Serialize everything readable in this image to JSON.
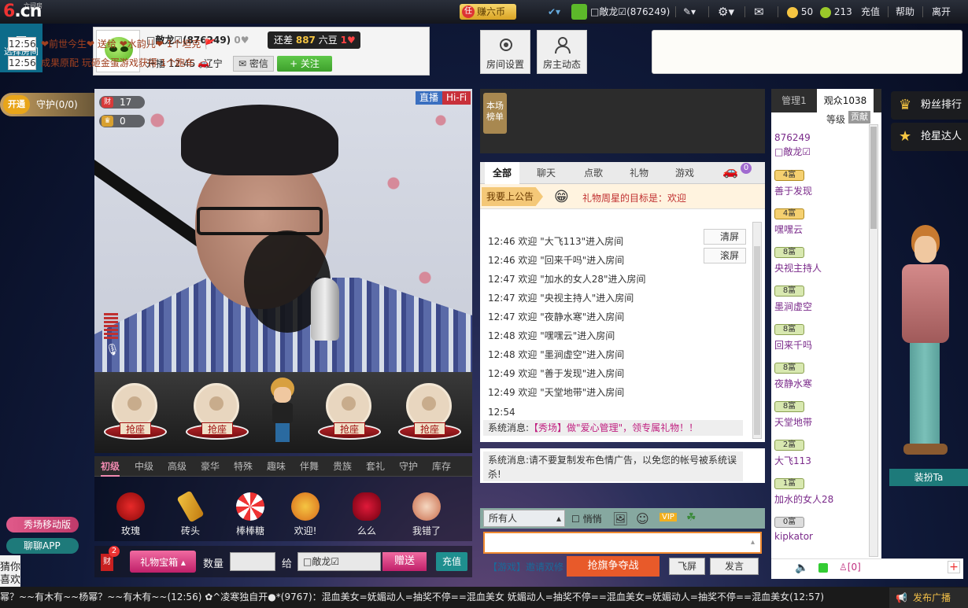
{
  "topbar": {
    "logo": "6.cn",
    "logo_sub": "六间房",
    "earn_label": "赚六币",
    "user_name": "□敵龙☑(876249)",
    "coins": "50",
    "beans": "213",
    "recharge": "充值",
    "help": "帮助",
    "leave": "离开"
  },
  "left": {
    "choose_room": "选择房间",
    "guard_open": "开通",
    "guard_label": "守护(0/0)",
    "mobile_show": "秀场移动版",
    "chat_app": "聊聊APP",
    "guess_like": "猜你喜欢"
  },
  "anchor": {
    "name": "□敵龙☑(876249)",
    "gap_prefix": "还差",
    "gap_value": "887",
    "gap_suffix": "六豆",
    "heart_count": "1",
    "live_time": "开播 12:45",
    "location": "辽宁",
    "msg_btn": "密信",
    "follow_btn": "+ 关注"
  },
  "room_buttons": {
    "settings": "房间设置",
    "host_news": "房主动态"
  },
  "gift_ticker": [
    {
      "time": "12:56",
      "text": "❤前世今生❤ 送给 ❤水韵儿❤ 1个坦克"
    },
    {
      "time": "12:56",
      "text": "成果原配 玩砸金蛋游戏获得 1个跑车"
    }
  ],
  "video": {
    "live_tag": "直播",
    "hifi_tag": "Hi-Fi",
    "fortune_count": "17",
    "crown_count": "0"
  },
  "seats": {
    "grab_label": "抢座"
  },
  "gift_tabs": [
    "初级",
    "中级",
    "高级",
    "豪华",
    "特殊",
    "趣味",
    "伴舞",
    "贵族",
    "套礼",
    "守护",
    "库存"
  ],
  "gifts": [
    "玫瑰",
    "砖头",
    "棒棒糖",
    "欢迎!",
    "么么",
    "我错了"
  ],
  "send_row": {
    "fortune_badge": "2",
    "fortune": "财",
    "gift_box": "礼物宝箱",
    "qty_label": "数量",
    "to_label": "给",
    "to_value": "□敵龙☑",
    "give": "赠送",
    "recharge": "充值"
  },
  "rank": {
    "tag": "本场榜单"
  },
  "chat_tabs": [
    "全部",
    "聊天",
    "点歌",
    "礼物",
    "游戏"
  ],
  "car_badge": "0",
  "notice": {
    "btn": "我要上公告",
    "text": "礼物周星的目标是：欢迎"
  },
  "chat_lines": [
    "12:46 欢迎 \"大飞113\"进入房间",
    "12:46 欢迎 \"回来千吗\"进入房间",
    "12:47 欢迎 \"加水的女人28\"进入房间",
    "12:47 欢迎 \"央视主持人\"进入房间",
    "12:47 欢迎 \"夜静水寒\"进入房间",
    "12:48 欢迎 \"嘿嘿云\"进入房间",
    "12:48 欢迎 \"墨涧虚空\"进入房间",
    "12:49 欢迎 \"善于发现\"进入房间",
    "12:49 欢迎 \"天堂地带\"进入房间"
  ],
  "chat_time": "12:54",
  "sys_msg_prefix": "系统消息:",
  "sys_msg_link": "【秀场】做\"爱心管理\"，领专属礼物！！",
  "warn_msg": "系统消息:请不要复制发布色情广告，以免您的帐号被系统误杀!",
  "clear_btn": "清屏",
  "scroll_btn": "滚屏",
  "chat_tool": {
    "who": "所有人",
    "quiet": "悄悄",
    "vip": "VIP"
  },
  "chat_bottom": {
    "game_link": "【游戏】邀请双修",
    "grab": "抢旗争夺战",
    "fly": "飞屏",
    "say": "发言"
  },
  "audience": {
    "tab_admin": "管理1",
    "tab_audience": "观众1038",
    "level_label": "等级",
    "contrib_label": "贡献",
    "users": [
      {
        "lv": "",
        "name": "876249",
        "sub": "□敵龙☑"
      },
      {
        "lv": "4富",
        "name": "善于发现"
      },
      {
        "lv": "4富",
        "name": "嘿嘿云"
      },
      {
        "lv": "8富",
        "name": "央视主持人"
      },
      {
        "lv": "8富",
        "name": "墨涧虚空"
      },
      {
        "lv": "8富",
        "name": "回来千吗"
      },
      {
        "lv": "8富",
        "name": "夜静水寒"
      },
      {
        "lv": "8富",
        "name": "天堂地带"
      },
      {
        "lv": "2富",
        "name": "大飞113"
      },
      {
        "lv": "1富",
        "name": "加水的女人28"
      },
      {
        "lv": "0富",
        "name": "kipkator"
      }
    ],
    "foot_count": "[0]"
  },
  "right": {
    "fans_rank": "粉丝排行",
    "star_rank": "抢星达人",
    "dress_up": "装扮Ta"
  },
  "bottom": {
    "ticker": "幂？~~有木有~~杨幂？~~有木有~~(12:56)    ✿^凌寒独自开●*(9767)：混血美女=妩媚动人=抽奖不停==混血美女 妩媚动人=抽奖不停==混血美女=妩媚动人=抽奖不停==混血美女(12:57)",
    "publish": "发布广播"
  }
}
